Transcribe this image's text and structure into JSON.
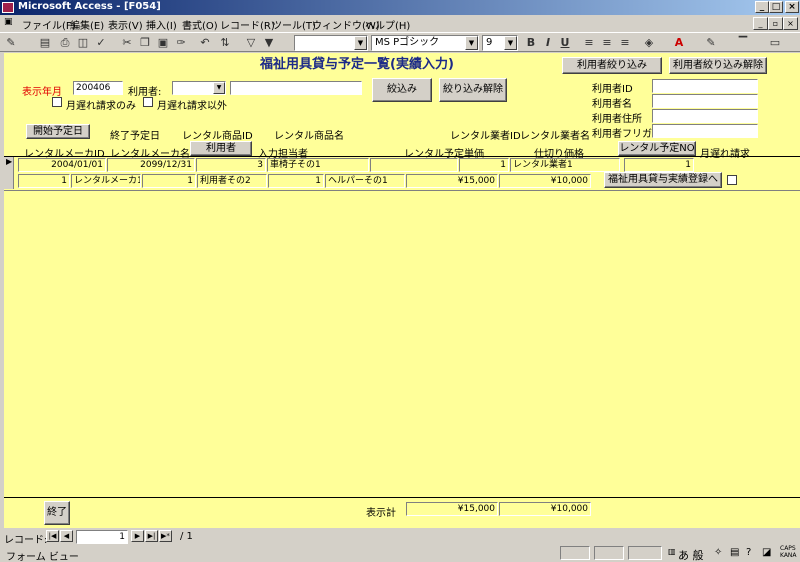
{
  "window": {
    "title": "Microsoft Access - [F054]"
  },
  "menu": [
    "ファイル(F)",
    "編集(E)",
    "表示(V)",
    "挿入(I)",
    "書式(O)",
    "レコード(R)",
    "ツール(T)",
    "ウィンドウ(W)",
    "ヘルプ(H)"
  ],
  "toolbar": {
    "font_name": "MS Pゴシック",
    "font_size": "9",
    "bold": "B",
    "italic": "I",
    "underline": "U"
  },
  "form": {
    "title": "福祉用具貸与予定一覧(実績入力)",
    "filter": {
      "year_month_label": "表示年月",
      "year_month_value": "200406",
      "user_label": "利用者:",
      "user_name_value": "",
      "overdue_only_label": "月遅れ請求のみ",
      "exclude_overdue_label": "月遅れ請求以外",
      "filter_button": "絞込み",
      "clear_filter_button": "絞り込み解除"
    },
    "user_filter_button": "利用者絞り込み",
    "user_filter_clear_button": "利用者絞り込み解除",
    "user_info": {
      "id_label": "利用者ID",
      "name_label": "利用者名",
      "address_label": "利用者住所",
      "kana_label": "利用者フリガナ"
    },
    "headers": {
      "start_date": "開始予定日",
      "end_date": "終了予定日",
      "rental_item_id": "レンタル商品ID",
      "rental_item_name": "レンタル商品名",
      "vendor_id": "レンタル業者ID",
      "vendor_name": "レンタル業者名",
      "maker_id": "レンタルメーカID",
      "maker_name": "レンタルメーカ名",
      "user_button": "利用者",
      "staff": "入力担当者",
      "unit_price": "レンタル予定単価",
      "purchase_price": "仕切り価格",
      "plan_no_button": "レンタル予定NO",
      "overdue": "月遅れ請求"
    },
    "record": {
      "start_date": "2004/01/01",
      "end_date": "2099/12/31",
      "item_id": "3",
      "item_name": "車椅子その1",
      "blank1": "",
      "vendor_id": "1",
      "vendor_name": "レンタル業者1",
      "plan_no": "1",
      "maker_id": "1",
      "maker_name": "レンタルメーカ1",
      "user_id": "1",
      "user_name": "利用者その2",
      "staff_id": "1",
      "staff_name": "ヘルパーその1",
      "unit_price": "¥15,000",
      "purchase_price": "¥10,000",
      "register_button": "福祉用具貸与実績登録へ"
    },
    "footer": {
      "end_button": "終了",
      "total_label": "表示計",
      "total_unit": "¥15,000",
      "total_purchase": "¥10,000"
    }
  },
  "nav": {
    "label": "レコード:",
    "current": "1",
    "total": "/ 1"
  },
  "status": {
    "text": "フォーム ビュー",
    "ime": "あ 般"
  }
}
